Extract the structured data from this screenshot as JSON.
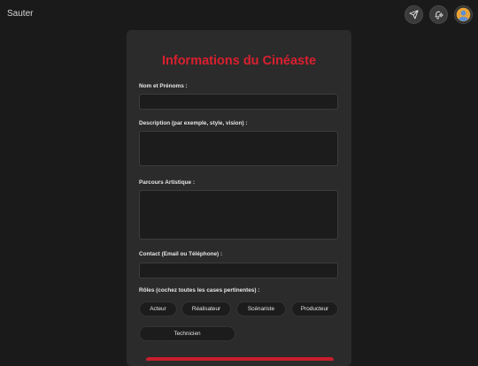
{
  "nav": {
    "skip_label": "Sauter"
  },
  "header": {
    "icons": [
      "send-icon",
      "notification-settings-icon",
      "user-avatar"
    ]
  },
  "form": {
    "title": "Informations du Cinéaste",
    "fields": {
      "name": {
        "label": "Nom et Prénoms :",
        "value": ""
      },
      "description": {
        "label": "Description (par exemple, style, vision) :",
        "value": ""
      },
      "career": {
        "label": "Parcours Artistique :",
        "value": ""
      },
      "contact": {
        "label": "Contact (Email ou Téléphone) :",
        "value": ""
      }
    },
    "roles_label": "Rôles (cochez toutes les cases pertinentes) :",
    "roles": [
      "Acteur",
      "Réalisateur",
      "Scénariste",
      "Producteur",
      "Technicien"
    ]
  },
  "colors": {
    "background": "#1a1a1a",
    "card": "#2b2b2b",
    "input": "#1c1c1c",
    "accent": "#d9202f"
  }
}
